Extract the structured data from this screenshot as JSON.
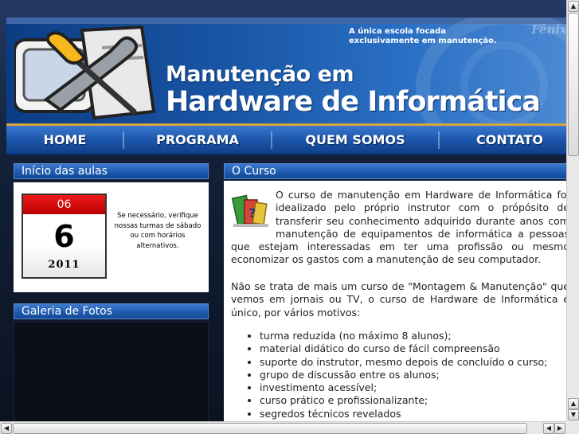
{
  "header": {
    "tagline": "A única escola focada exclusivamente em manutenção.",
    "brand_mark": "Fênix",
    "title_line1": "Manutenção em",
    "title_line2": "Hardware de Informática"
  },
  "nav": {
    "items": [
      {
        "label": "HOME"
      },
      {
        "label": "PROGRAMA"
      },
      {
        "label": "QUEM SOMOS"
      },
      {
        "label": "CONTATO"
      }
    ]
  },
  "start": {
    "title": "Início das aulas",
    "calendar": {
      "month": "06",
      "day": "6",
      "year": "2011"
    },
    "note": "Se necessário, verifique nossas turmas de sábado ou com horários alternativos."
  },
  "gallery": {
    "title": "Galeria de Fotos"
  },
  "course": {
    "title": "O Curso",
    "paragraph1": "O curso de manutenção em Hardware de Informática foi idealizado pelo próprio instrutor com o própósito de transferir seu conhecimento adquirido durante anos com manutenção de equipamentos de informática a pessoas que estejam interessadas em ter uma profissão ou mesmo economizar os gastos com a manutenção de seu computador.",
    "paragraph2": "Não se trata de mais um curso de \"Montagem & Manutenção\" que vemos em jornais ou TV, o curso de Hardware de Informática é único, por vários motivos:",
    "reasons": [
      "turma reduzida (no máximo 8 alunos);",
      "material didático do curso de fácil compreensão",
      "suporte do instrutor, mesmo depois de concluído o curso;",
      "grupo de discussão entre os alunos;",
      "investimento acessível;",
      "curso prático e profissionalizante;",
      "segredos técnicos revelados"
    ]
  },
  "colors": {
    "header_blue": "#1a56a6",
    "nav_border_gold": "#d9a63a",
    "calendar_red": "#e00000",
    "background": "#0f1626"
  }
}
